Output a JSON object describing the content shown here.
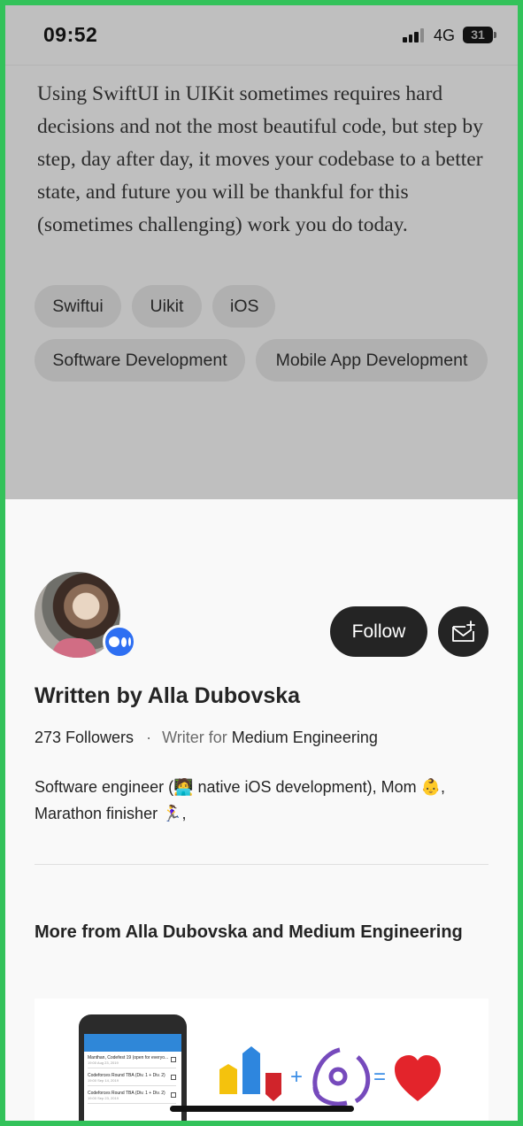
{
  "status_bar": {
    "time": "09:52",
    "network": "4G",
    "battery": "31"
  },
  "article": {
    "closing_paragraph": "Using SwiftUI in UIKit sometimes requires hard decisions and not the most beautiful code, but step by step, day after day, it moves your codebase to a better state, and future you will be thankful for this (sometimes challenging) work you do today.",
    "tags": [
      "Swiftui",
      "Uikit",
      "iOS",
      "Software Development",
      "Mobile App Development"
    ]
  },
  "author": {
    "follow_label": "Follow",
    "written_by": "Written by Alla Dubovska",
    "followers": "273 Followers",
    "separator": "·",
    "writer_for_label": "Writer for",
    "publication": "Medium Engineering",
    "bio": "Software engineer (🧑‍💻 native iOS development), Mom 👶, Marathon finisher 🏃‍♀️,"
  },
  "more_from": {
    "heading": "More from Alla Dubovska and Medium Engineering"
  },
  "preview": {
    "rows": [
      {
        "title": "Manthan, Codefest 19 (open for everyo...",
        "date": "19:00 Aug 23, 2019"
      },
      {
        "title": "Codeforces Round TBA (Div. 1 + Div. 2)",
        "date": "19:00 Sep 14, 2019"
      },
      {
        "title": "Codeforces Round TBA (Div. 1 + Div. 2)",
        "date": "19:00 Sep 23, 2019"
      }
    ],
    "plus": "+",
    "equals": "="
  },
  "colors": {
    "frame": "#33c25a",
    "overlay": "#bfbfbf",
    "button": "#242424",
    "badge": "#2e6ff2",
    "heart": "#e3242b",
    "redux": "#764abc"
  },
  "icons": [
    "cell-signal-icon",
    "battery-icon",
    "medium-logo-icon",
    "mail-plus-icon",
    "bar-chart-logo-icon",
    "redux-logo-icon",
    "heart-icon"
  ]
}
